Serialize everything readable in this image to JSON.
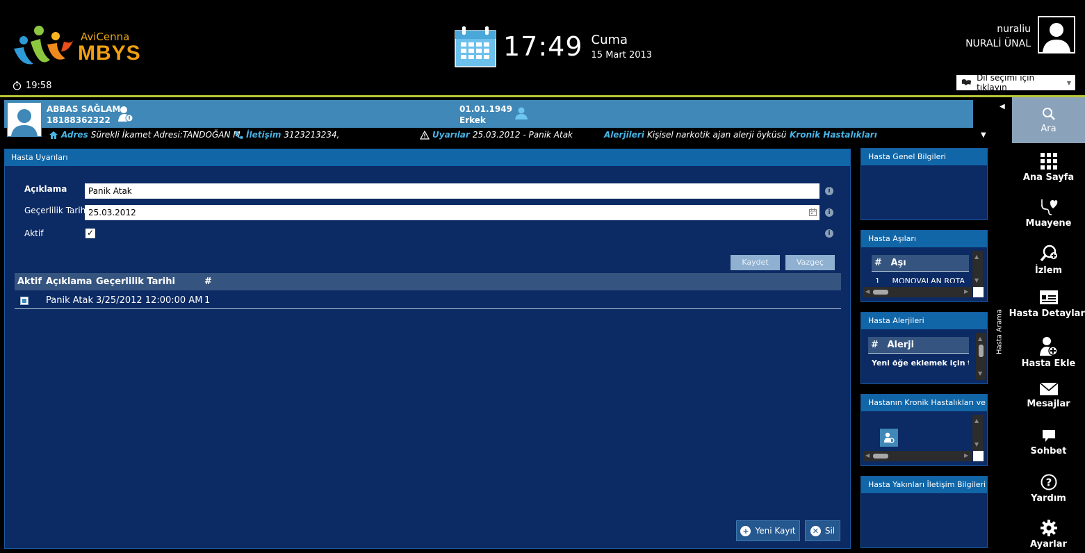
{
  "header": {
    "brand_top": "AviCenna",
    "brand_main": "MBYS",
    "session_time": "19:58",
    "clock": "17:49",
    "day_name": "Cuma",
    "date": "15 Mart 2013",
    "username": "nuraliu",
    "fullname": "NURALİ ÜNAL",
    "language_select": "Dil seçimi için tıklayın"
  },
  "patient": {
    "name": "ABBAS SAĞLAM",
    "id": "18188362322",
    "dob": "01.01.1949",
    "gender": "Erkek",
    "address_label": "Adres",
    "address": "Sürekli İkamet Adresi:TANDOĞAN M",
    "contact_label": "İletişim",
    "contact": "3123213234,",
    "warnings_label": "Uyarılar",
    "warnings": "25.03.2012 - Panik Atak",
    "allergies_label": "Alerjileri",
    "allergies": "Kişisel narkotik ajan alerji öyküsü",
    "chronic_label": "Kronik Hastalıkları"
  },
  "main": {
    "title": "Hasta Uyarıları",
    "form": {
      "description_label": "Açıklama",
      "description_value": "Panik Atak",
      "validity_label": "Geçerlilik Tarihi",
      "validity_value": "25.03.2012",
      "active_label": "Aktif",
      "active_checked": true,
      "save_label": "Kaydet",
      "cancel_label": "Vazgeç"
    },
    "table": {
      "columns": [
        "Aktif",
        "Açıklama",
        "Geçerlilik Tarihi",
        "#"
      ],
      "rows": [
        {
          "active": true,
          "description": "Panik Atak",
          "validity": "3/25/2012 12:00:00 AM",
          "no": "1"
        }
      ]
    },
    "new_record_label": "Yeni Kayıt",
    "delete_label": "Sil"
  },
  "widgets": {
    "general_info": {
      "title": "Hasta Genel Bilgileri"
    },
    "vaccines": {
      "title": "Hasta Aşıları",
      "col_no": "#",
      "col_name": "Aşı",
      "row_no": "1",
      "row_name": "MONOVALAN ROTA"
    },
    "allergies": {
      "title": "Hasta Alerjileri",
      "col_no": "#",
      "col_name": "Alerji",
      "add_hint": "Yeni öğe eklemek için tıkla"
    },
    "chronic": {
      "title": "Hastanın Kronik Hastalıkları ve İlaçları"
    },
    "relatives": {
      "title": "Hasta Yakınları İletişim Bilgileri"
    }
  },
  "side_tab": "Hasta Arama",
  "nav": {
    "search": "Ara",
    "home": "Ana Sayfa",
    "examination": "Muayene",
    "monitoring": "İzlem",
    "patient_details": "Hasta Detayları",
    "add_patient": "Hasta Ekle",
    "messages": "Mesajlar",
    "chat": "Sohbet",
    "help": "Yardım",
    "settings": "Ayarlar"
  },
  "colors": {
    "header_bg": "#000000",
    "patient_bar": "#3f88b8",
    "panel_bg": "#0c2a63",
    "panel_head": "#1166a8",
    "accent_rule": "#b9c837",
    "link_blue": "#47b4e6",
    "brand_orange": "#f0a010"
  }
}
